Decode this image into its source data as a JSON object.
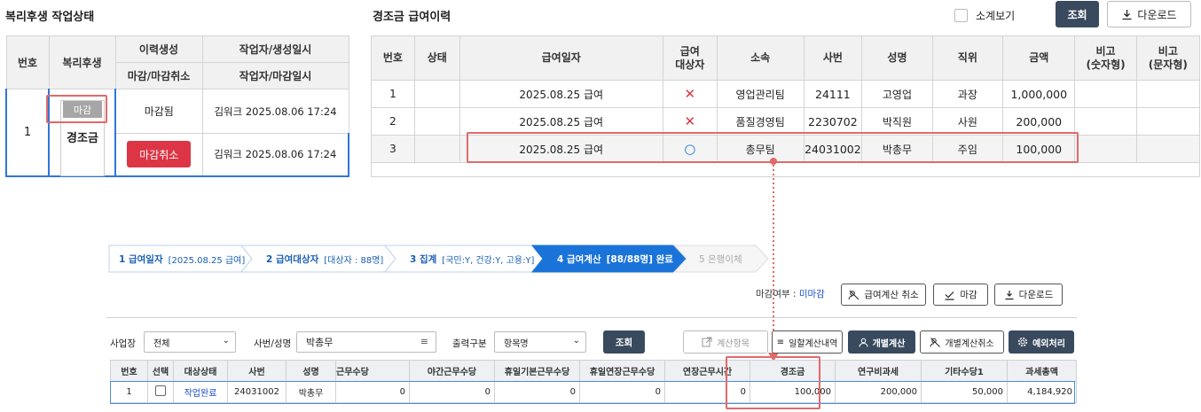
{
  "left": {
    "title": "복리후생 작업상태",
    "header": {
      "no": "번호",
      "welfare": "복리후생",
      "history": "이력생성",
      "creator": "작업자/생성일시",
      "close_cancel": "마감/마감취소",
      "closer": "작업자/마감일시"
    },
    "row": {
      "no": "1",
      "status_badge": "마감",
      "item": "경조금",
      "closed_text": "마감됨",
      "created_by": "김워크 2025.08.06 17:24",
      "cancel_button": "마감취소",
      "closed_by": "김워크 2025.08.06 17:24"
    }
  },
  "right": {
    "title": "경조금 급여이력",
    "subtotal_label": "소계보기",
    "search_button": "조회",
    "download_button": "다운로드",
    "columns": [
      "번호",
      "상태",
      "급여일자",
      "급여\n대상자",
      "소속",
      "사번",
      "성명",
      "직위",
      "금액",
      "비고\n(숫자형)",
      "비고\n(문자형)"
    ],
    "rows": [
      {
        "no": "1",
        "status": "",
        "date": "2025.08.25 급여",
        "target": "✕",
        "dept": "영업관리팀",
        "emp_no": "24111",
        "name": "고영업",
        "position": "과장",
        "amount": "1,000,000",
        "note_num": "",
        "note_text": ""
      },
      {
        "no": "2",
        "status": "",
        "date": "2025.08.25 급여",
        "target": "✕",
        "dept": "품질경영팀",
        "emp_no": "2230702",
        "name": "박직원",
        "position": "사원",
        "amount": "200,000",
        "note_num": "",
        "note_text": ""
      },
      {
        "no": "3",
        "status": "",
        "date": "2025.08.25 급여",
        "target": "○",
        "dept": "총무팀",
        "emp_no": "24031002",
        "name": "박총무",
        "position": "주임",
        "amount": "100,000",
        "note_num": "",
        "note_text": ""
      }
    ]
  },
  "wizard": {
    "steps": [
      {
        "label": "1  급여일자",
        "detail": "[2025.08.25 급여]",
        "state": "done"
      },
      {
        "label": "2  급여대상자",
        "detail": "[대상자 : 88명]",
        "state": "done"
      },
      {
        "label": "3  집계",
        "detail": "[국민:Y, 건강:Y, 고용:Y]",
        "state": "done"
      },
      {
        "label": "4  급여계산",
        "detail": "[88/88명] 완료",
        "state": "active"
      },
      {
        "label": "5  은행이체",
        "detail": "",
        "state": "pending"
      }
    ],
    "close_status_label": "마감여부 : ",
    "close_status_value": "미마감",
    "buttons": {
      "cancel_calc": "급여계산 취소",
      "close": "마감",
      "download": "다운로드"
    }
  },
  "filter": {
    "site_label": "사업장",
    "site_value": "전체",
    "emp_label": "사번/성명",
    "emp_value": "박총무",
    "output_label": "출력구분",
    "output_value": "항목명",
    "search": "조회",
    "calc_items": "계산항목",
    "batch_calc": "일할계산내역",
    "individual_calc": "개별계산",
    "individual_cancel": "개별계산취소",
    "exception": "예외처리"
  },
  "bottom_table": {
    "columns": [
      "번호",
      "선택",
      "대상상태",
      "사번",
      "성명",
      "근무수당",
      "야간근무수당",
      "휴일기본근무수당",
      "휴일연장근무수당",
      "연장근무시간",
      "경조금",
      "연구비과세",
      "기타수당1",
      "과세총액"
    ],
    "row": {
      "no": "1",
      "status": "작업완료",
      "emp_no": "24031002",
      "name": "박총무",
      "work": "0",
      "night": "0",
      "holiday_base": "0",
      "holiday_ext": "0",
      "overtime": "0",
      "condolence": "100,000",
      "research": "200,000",
      "etc1": "50,000",
      "taxable": "4,184,920"
    }
  },
  "colors": {
    "accent_red": "#e06a6a",
    "danger": "#dc3545",
    "step_blue": "#1a73d9",
    "dark_button": "#3a4a5e",
    "close_value": "#1a4fc4"
  }
}
